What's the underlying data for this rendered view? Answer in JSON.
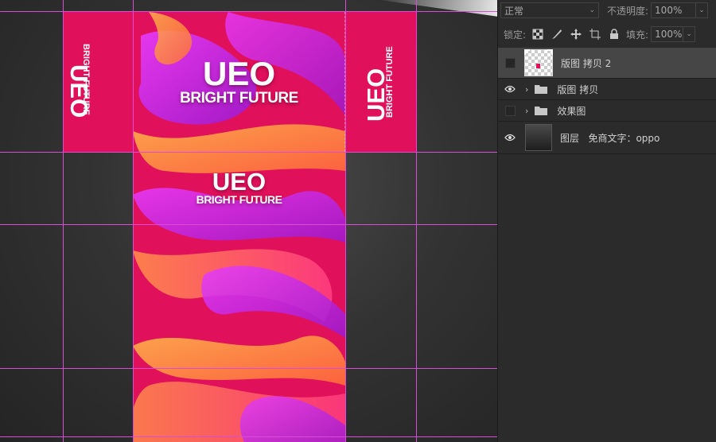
{
  "artwork": {
    "side_title": "UEO",
    "side_subtitle": "BRIGHT FUTURE",
    "front_title": "UEO",
    "front_subtitle": "BRIGHT FUTURE",
    "top_title": "UEO",
    "top_subtitle": "BRIGHT FUTURE",
    "colors": {
      "pink": "#e0105a",
      "orange": "#ff9a40",
      "purple": "#c22ce0"
    }
  },
  "panel": {
    "blend_mode": "正常",
    "opacity_label": "不透明度:",
    "opacity_value": "100%",
    "lock_label": "锁定:",
    "fill_label": "填充:",
    "fill_value": "100%",
    "layers": [
      {
        "name": "版图 拷贝 2",
        "visible": false,
        "type": "smart",
        "selected": true
      },
      {
        "name": "版图 拷贝",
        "visible": true,
        "type": "group"
      },
      {
        "name": "效果图",
        "visible": false,
        "type": "group"
      },
      {
        "name": "图层   免商文字：oppo",
        "visible": true,
        "type": "image"
      }
    ]
  }
}
